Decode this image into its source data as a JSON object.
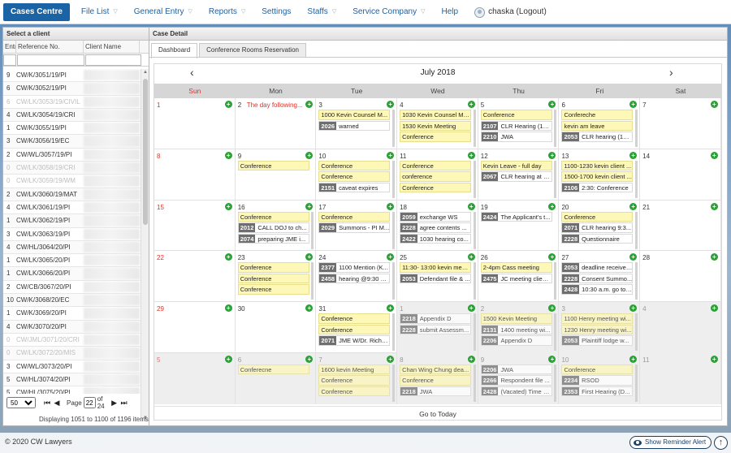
{
  "nav": {
    "items": [
      {
        "label": "Cases Centre",
        "active": true,
        "caret": false
      },
      {
        "label": "File List",
        "active": false,
        "caret": true
      },
      {
        "label": "General Entry",
        "active": false,
        "caret": true
      },
      {
        "label": "Reports",
        "active": false,
        "caret": true
      },
      {
        "label": "Settings",
        "active": false,
        "caret": false
      },
      {
        "label": "Staffs",
        "active": false,
        "caret": true
      },
      {
        "label": "Service Company",
        "active": false,
        "caret": true
      },
      {
        "label": "Help",
        "active": false,
        "caret": false
      }
    ],
    "user": "chaska (Logout)"
  },
  "left": {
    "title": "Select a client",
    "columns": [
      "Entr",
      "Reference No.",
      "Client Name"
    ],
    "rows": [
      {
        "entry": "9",
        "ref": "CW/K/3051/19/PI",
        "dim": false
      },
      {
        "entry": "6",
        "ref": "CW/K/3052/19/PI",
        "dim": false
      },
      {
        "entry": "6",
        "ref": "CW/LK/3053/19/CIVIL",
        "dim": true
      },
      {
        "entry": "4",
        "ref": "CW/LK/3054/19/CRI",
        "dim": false
      },
      {
        "entry": "1",
        "ref": "CW/K/3055/19/PI",
        "dim": false
      },
      {
        "entry": "3",
        "ref": "CW/K/3056/19/EC",
        "dim": false
      },
      {
        "entry": "2",
        "ref": "CW/WL/3057/19/PI",
        "dim": false
      },
      {
        "entry": "0",
        "ref": "CW/LK/3058/19/CRI",
        "dim": true
      },
      {
        "entry": "0",
        "ref": "CW/LK/3059/19/WM",
        "dim": true
      },
      {
        "entry": "2",
        "ref": "CW/LK/3060/19/MAT",
        "dim": false
      },
      {
        "entry": "4",
        "ref": "CW/LK/3061/19/PI",
        "dim": false
      },
      {
        "entry": "1",
        "ref": "CW/LK/3062/19/PI",
        "dim": false
      },
      {
        "entry": "3",
        "ref": "CW/LK/3063/19/PI",
        "dim": false
      },
      {
        "entry": "4",
        "ref": "CW/HL/3064/20/PI",
        "dim": false
      },
      {
        "entry": "1",
        "ref": "CW/LK/3065/20/PI",
        "dim": false
      },
      {
        "entry": "1",
        "ref": "CW/LK/3066/20/PI",
        "dim": false
      },
      {
        "entry": "2",
        "ref": "CW/CB/3067/20/PI",
        "dim": false
      },
      {
        "entry": "10",
        "ref": "CW/K/3068/20/EC",
        "dim": false
      },
      {
        "entry": "1",
        "ref": "CW/K/3069/20/PI",
        "dim": false
      },
      {
        "entry": "4",
        "ref": "CW/K/3070/20/PI",
        "dim": false
      },
      {
        "entry": "0",
        "ref": "CW/JML/3071/20/CRI",
        "dim": true
      },
      {
        "entry": "0",
        "ref": "CW/LK/3072/20/MIS",
        "dim": true
      },
      {
        "entry": "3",
        "ref": "CW/WL/3073/20/PI",
        "dim": false
      },
      {
        "entry": "5",
        "ref": "CW/HL/3074/20/PI",
        "dim": false
      },
      {
        "entry": "5",
        "ref": "CW/HL/3075/20/PI",
        "dim": false
      }
    ],
    "pager": {
      "page_size": "50",
      "page_label": "Page",
      "page": "22",
      "of_label": "of",
      "total_pages": "24"
    },
    "display_info": "Displaying 1051 to 1100 of 1196 items"
  },
  "right": {
    "title": "Case Detail",
    "tabs": [
      "Dashboard",
      "Conference Rooms Reservation"
    ],
    "calendar": {
      "month": "July 2018",
      "days_of_week": [
        "Sun",
        "Mon",
        "Tue",
        "Wed",
        "Thu",
        "Fri",
        "Sat"
      ],
      "goto": "Go to Today",
      "weeks": [
        [
          {
            "n": "1",
            "events": []
          },
          {
            "n": "2",
            "holiday": "The day following...",
            "events": []
          },
          {
            "n": "3",
            "events": [
              {
                "t": "1000 Kevin Counsel M...",
                "y": true
              },
              {
                "c": "2026",
                "t": "warned"
              }
            ]
          },
          {
            "n": "4",
            "events": [
              {
                "t": "1030 Kevin Counsel Me...",
                "y": true
              },
              {
                "t": "1530 Kevin Meeting",
                "y": true
              },
              {
                "t": "Conference",
                "y": true
              }
            ]
          },
          {
            "n": "5",
            "events": [
              {
                "t": "Conference",
                "y": true
              },
              {
                "c": "2107",
                "t": "CLR Hearing (10..."
              },
              {
                "c": "2210",
                "t": "JWA"
              }
            ]
          },
          {
            "n": "6",
            "events": [
              {
                "t": "Confereche",
                "y": true
              },
              {
                "t": "kevin am leave",
                "y": true
              },
              {
                "c": "2053",
                "t": "CLR hearing (10:..."
              }
            ]
          },
          {
            "n": "7",
            "events": []
          }
        ],
        [
          {
            "n": "8",
            "events": []
          },
          {
            "n": "9",
            "events": [
              {
                "t": "Conference",
                "y": true
              }
            ]
          },
          {
            "n": "10",
            "events": [
              {
                "t": "Conference",
                "y": true
              },
              {
                "t": "Conference",
                "y": true
              },
              {
                "c": "2151",
                "t": "caveat expires"
              }
            ]
          },
          {
            "n": "11",
            "events": [
              {
                "t": "Conference",
                "y": true
              },
              {
                "t": "conference",
                "y": true
              },
              {
                "t": "Conference",
                "y": true
              }
            ]
          },
          {
            "n": "12",
            "events": [
              {
                "t": "Kevin Leave - full day",
                "y": true
              },
              {
                "c": "2067",
                "t": "CLR hearing at 1..."
              }
            ]
          },
          {
            "n": "13",
            "events": [
              {
                "t": "1100-1230 kevin client ...",
                "y": true
              },
              {
                "t": "1500-1700 kevin client ...",
                "y": true
              },
              {
                "c": "2106",
                "t": "2:30: Conference"
              }
            ]
          },
          {
            "n": "14",
            "events": []
          }
        ],
        [
          {
            "n": "15",
            "events": []
          },
          {
            "n": "16",
            "events": [
              {
                "t": "Conference",
                "y": true
              },
              {
                "c": "2012",
                "t": "CALL DOJ to ch..."
              },
              {
                "c": "2074",
                "t": "preparing JME i..."
              }
            ]
          },
          {
            "n": "17",
            "events": [
              {
                "t": "Conference",
                "y": true
              },
              {
                "c": "2029",
                "t": "Summons - PI M..."
              }
            ]
          },
          {
            "n": "18",
            "events": [
              {
                "c": "2059",
                "t": "exchange WS"
              },
              {
                "c": "2228",
                "t": "agree contents ..."
              },
              {
                "c": "2422",
                "t": "1030 hearing co..."
              }
            ]
          },
          {
            "n": "19",
            "events": [
              {
                "c": "2424",
                "t": "The Applicant's t..."
              }
            ]
          },
          {
            "n": "20",
            "events": [
              {
                "t": "Conference",
                "y": true
              },
              {
                "c": "2071",
                "t": "CLR hearing 9:3..."
              },
              {
                "c": "2228",
                "t": "Questionnaire"
              }
            ]
          },
          {
            "n": "21",
            "events": []
          }
        ],
        [
          {
            "n": "22",
            "events": []
          },
          {
            "n": "23",
            "events": [
              {
                "t": "Conference",
                "y": true
              },
              {
                "t": "Conference",
                "y": true
              },
              {
                "t": "Conference",
                "y": true
              }
            ]
          },
          {
            "n": "24",
            "events": [
              {
                "c": "2377",
                "t": "1100 Mention (K..."
              },
              {
                "c": "2458",
                "t": "hearing @9:30 K..."
              }
            ]
          },
          {
            "n": "25",
            "events": [
              {
                "t": "11:30- 13:00 kevin meet...",
                "y": true
              },
              {
                "c": "2053",
                "t": "Defendant file & ..."
              }
            ]
          },
          {
            "n": "26",
            "events": [
              {
                "t": "2-4pm Cass meeting",
                "y": true
              },
              {
                "c": "2475",
                "t": "JC meeting client..."
              }
            ]
          },
          {
            "n": "27",
            "events": [
              {
                "c": "2053",
                "t": "deadline receive j..."
              },
              {
                "c": "2228",
                "t": "Consent Summo..."
              },
              {
                "c": "2428",
                "t": "10:30 a.m. go to ..."
              }
            ]
          },
          {
            "n": "28",
            "events": []
          }
        ],
        [
          {
            "n": "29",
            "events": []
          },
          {
            "n": "30",
            "events": []
          },
          {
            "n": "31",
            "events": [
              {
                "t": "Conference",
                "y": true
              },
              {
                "t": "Conference",
                "y": true
              },
              {
                "c": "2071",
                "t": "JME W/Dr. Richa..."
              }
            ]
          },
          {
            "n": "1",
            "other": true,
            "events": [
              {
                "c": "2218",
                "t": "Appendix D"
              },
              {
                "c": "2228",
                "t": "submit Assessm..."
              }
            ]
          },
          {
            "n": "2",
            "other": true,
            "events": [
              {
                "t": "1500 Kevin Meeting",
                "y": true
              },
              {
                "c": "2131",
                "t": "1400 meeting wi..."
              },
              {
                "c": "2206",
                "t": "Appendix D"
              }
            ]
          },
          {
            "n": "3",
            "other": true,
            "events": [
              {
                "t": "1100 Henry meeting wi...",
                "y": true
              },
              {
                "t": "1230 Henry meeting wi...",
                "y": true
              },
              {
                "c": "2053",
                "t": "Plaintiff lodge w..."
              }
            ]
          },
          {
            "n": "4",
            "other": true,
            "events": []
          }
        ],
        [
          {
            "n": "5",
            "other": true,
            "events": []
          },
          {
            "n": "6",
            "other": true,
            "events": [
              {
                "t": "Conferecne",
                "y": true
              }
            ]
          },
          {
            "n": "7",
            "other": true,
            "events": [
              {
                "t": "1600 kevin Meeting",
                "y": true
              },
              {
                "t": "Conference",
                "y": true
              },
              {
                "t": "Conference",
                "y": true
              }
            ]
          },
          {
            "n": "8",
            "other": true,
            "events": [
              {
                "t": "Chan Wing Chung dea...",
                "y": true
              },
              {
                "t": "Conference",
                "y": true
              },
              {
                "c": "2218",
                "t": "JWA"
              }
            ]
          },
          {
            "n": "9",
            "other": true,
            "events": [
              {
                "c": "2206",
                "t": "JWA"
              },
              {
                "c": "2266",
                "t": "Respondent file ..."
              },
              {
                "c": "2428",
                "t": "(Vacated) Time S..."
              }
            ]
          },
          {
            "n": "10",
            "other": true,
            "events": [
              {
                "t": "Conference",
                "y": true
              },
              {
                "c": "2234",
                "t": "RSOD"
              },
              {
                "c": "2353",
                "t": "First Hearing (D..."
              }
            ]
          },
          {
            "n": "11",
            "other": true,
            "events": []
          }
        ]
      ]
    }
  },
  "footer": {
    "copyright": "© 2020 CW Lawyers",
    "reminder": "Show Reminder Alert"
  }
}
